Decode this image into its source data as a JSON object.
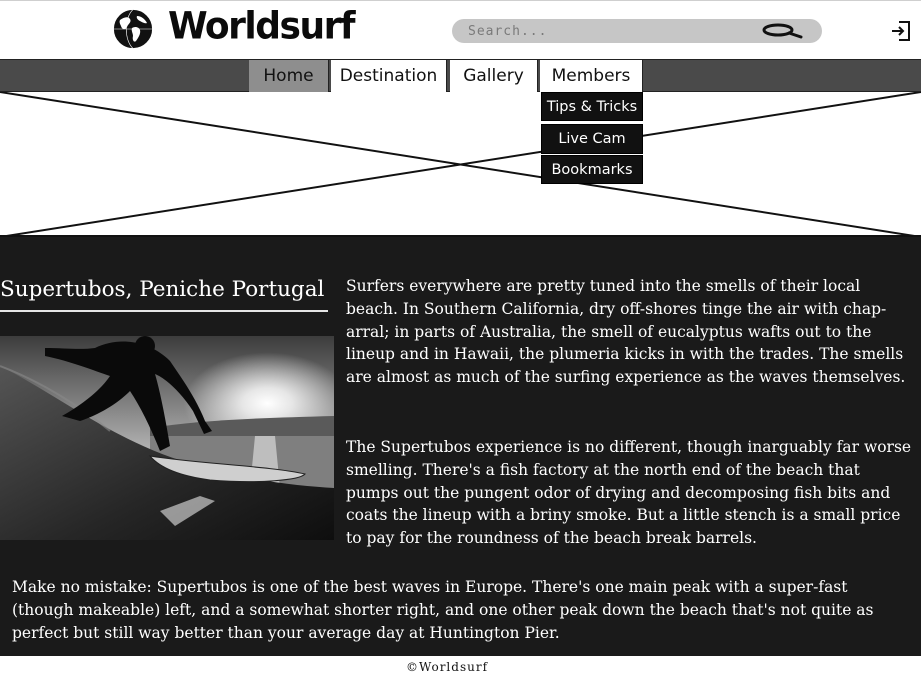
{
  "header": {
    "brand": "Worldsurf",
    "logo_icon": "globe-icon",
    "search_placeholder": "Search...",
    "search_icon": "search-icon",
    "login_icon": "login-icon"
  },
  "nav": {
    "items": [
      {
        "label": "Home",
        "active": true
      },
      {
        "label": "Destination",
        "active": false
      },
      {
        "label": "Gallery",
        "active": false
      },
      {
        "label": "Members",
        "active": false
      }
    ],
    "members_dropdown": [
      "Tips & Tricks",
      "Live Cam",
      "Bookmarks"
    ]
  },
  "hero": {
    "image": "image-placeholder"
  },
  "article": {
    "title": "Supertubos, Peniche Portugal",
    "photo": "surfer-photo",
    "paragraphs": [
      "Surfers everywhere are pretty tuned into the smells of their local beach. In Southern California, dry off-shores tinge the air with chap-arral; in parts of Australia, the smell of eucalyptus wafts out to the lineup and in Hawaii, the plumeria kicks in with the trades. The smells are almost as much of the surfing experience as the waves themselves.",
      "The Supertubos experience is no different, though inarguably far worse smelling. There's a fish factory at the north end of the beach that pumps out the pungent odor of drying and decomposing fish bits and coats the lineup with a briny smoke. But a little stench is a small price to pay for the roundness of the beach break barrels.",
      "Make no mistake: Supertubos is one of the best waves in Europe. There's one main peak with a super-fast (though makeable) left, and a somewhat shorter right, and one other peak down the beach that's not quite as perfect but still way better than your average day at Huntington Pier."
    ]
  },
  "footer": {
    "copyright": "©Worldsurf"
  },
  "colors": {
    "nav_bar": "#4a4a4a",
    "active_tab": "#8e8e8e",
    "content_bg": "#1a1a1a",
    "dropdown_bg": "#111111"
  }
}
